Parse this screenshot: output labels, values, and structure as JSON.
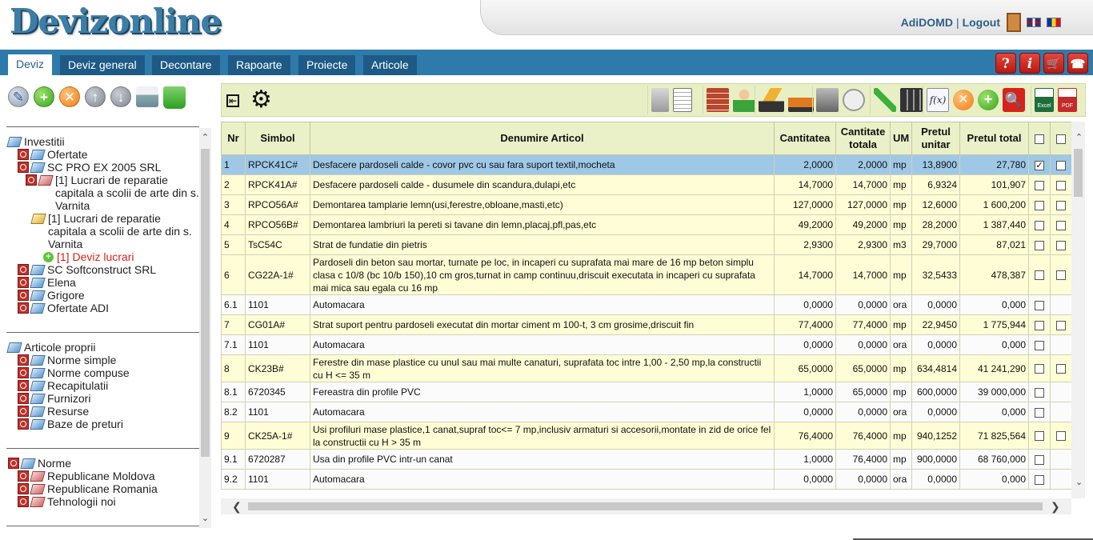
{
  "header": {
    "logo": "Devizonline",
    "user": "AdiDOMD",
    "separator": "|",
    "logout": "Logout"
  },
  "nav": {
    "tabs": [
      {
        "label": "Deviz",
        "active": true
      },
      {
        "label": "Deviz general",
        "active": false
      },
      {
        "label": "Decontare",
        "active": false
      },
      {
        "label": "Rapoarte",
        "active": false
      },
      {
        "label": "Proiecte",
        "active": false
      },
      {
        "label": "Articole",
        "active": false
      }
    ],
    "right_icons": [
      "help-icon",
      "info-icon",
      "cart-icon",
      "phone-icon"
    ],
    "help_label": "?",
    "info_label": "i",
    "cart_label": "🛒",
    "phone_label": "☎"
  },
  "left_toolbar": {
    "pencil": "✎",
    "add": "+",
    "remove": "✕",
    "up": "↑",
    "down": "↓"
  },
  "tree": {
    "investitii": "Investitii",
    "ofertate": "Ofertate",
    "sc_pro_ex": "SC PRO EX 2005 SRL",
    "lucrari_1": "[1] Lucrari de reparatie capitala a scolii de arte din s. Varnita",
    "lucrari_2": "[1] Lucrari de reparatie capitala a scolii de arte din s. Varnita",
    "deviz_lucrari": "[1] Deviz lucrari",
    "softconstruct": "SC Softconstruct SRL",
    "elena": "Elena",
    "grigore": "Grigore",
    "ofertate_adi": "Ofertate ADI",
    "articole_proprii": "Articole proprii",
    "norme_simple": "Norme simple",
    "norme_compuse": "Norme compuse",
    "recapitulatii": "Recapitulatii",
    "furnizori": "Furnizori",
    "resurse": "Resurse",
    "baze_preturi": "Baze de preturi",
    "norme": "Norme",
    "rep_moldova": "Republicane Moldova",
    "rep_romania": "Republicane Romania",
    "tehnologii": "Tehnologii noi"
  },
  "right_toolbar": {
    "back": "⇤",
    "gear": "⚙",
    "fx": "f(x)",
    "remove": "✕",
    "add": "+",
    "search": "🔍",
    "excel": "Excel",
    "pdf": "PDF"
  },
  "table": {
    "headers": {
      "nr": "Nr",
      "simbol": "Simbol",
      "denumire": "Denumire Articol",
      "cantitatea": "Cantitatea",
      "cantitate_totala": "Cantitate totala",
      "um": "UM",
      "pretul_unitar": "Pretul unitar",
      "pretul_total": "Pretul total"
    },
    "rows": [
      {
        "nr": "1",
        "simbol": "RPCK41C#",
        "denumire": "Desfacere pardoseli calde - covor pvc cu sau fara suport textil,mocheta",
        "cant": "2,0000",
        "cant_tot": "2,0000",
        "um": "mp",
        "pu": "13,8900",
        "pt": "27,780",
        "style": "sel",
        "cb1": "✓",
        "cb2": true
      },
      {
        "nr": "2",
        "simbol": "RPCK41A#",
        "denumire": "Desfacere pardoseli calde - dusumele din scandura,dulapi,etc",
        "cant": "14,7000",
        "cant_tot": "14,7000",
        "um": "mp",
        "pu": "6,9324",
        "pt": "101,907",
        "style": "yellow",
        "cb1": "",
        "cb2": true
      },
      {
        "nr": "3",
        "simbol": "RPCO56A#",
        "denumire": "Demontarea tamplarie lemn(usi,ferestre,obloane,masti,etc)",
        "cant": "127,0000",
        "cant_tot": "127,0000",
        "um": "mp",
        "pu": "12,6000",
        "pt": "1 600,200",
        "style": "yellow",
        "cb1": "",
        "cb2": true
      },
      {
        "nr": "4",
        "simbol": "RPCO56B#",
        "denumire": "Demontarea lambriuri la pereti si tavane din lemn,placaj,pfl,pas,etc",
        "cant": "49,2000",
        "cant_tot": "49,2000",
        "um": "mp",
        "pu": "28,2000",
        "pt": "1 387,440",
        "style": "yellow",
        "cb1": "",
        "cb2": true
      },
      {
        "nr": "5",
        "simbol": "TsC54C",
        "denumire": "Strat de fundatie din pietris",
        "cant": "2,9300",
        "cant_tot": "2,9300",
        "um": "m3",
        "pu": "29,7000",
        "pt": "87,021",
        "style": "yellow",
        "cb1": "",
        "cb2": true
      },
      {
        "nr": "6",
        "simbol": "CG22A-1#",
        "denumire": "Pardoseli din beton sau mortar, turnate pe loc, in incaperi cu suprafata mai mare de 16 mp beton simplu clasa c 10/8 (bc 10/b 150),10 cm gros,turnat in camp continuu,driscuit executata in incaperi cu suprafata mai mica sau egala cu 16 mp",
        "cant": "14,7000",
        "cant_tot": "14,7000",
        "um": "mp",
        "pu": "32,5433",
        "pt": "478,387",
        "style": "yellow",
        "cb1": "",
        "cb2": true
      },
      {
        "nr": "6.1",
        "simbol": "1101",
        "denumire": "Automacara",
        "cant": "0,0000",
        "cant_tot": "0,0000",
        "um": "ora",
        "pu": "0,0000",
        "pt": "0,000",
        "style": "white",
        "cb1": "",
        "cb2": false
      },
      {
        "nr": "7",
        "simbol": "CG01A#",
        "denumire": "Strat suport pentru pardoseli executat din mortar ciment m 100-t, 3 cm grosime,driscuit fin",
        "cant": "77,4000",
        "cant_tot": "77,4000",
        "um": "mp",
        "pu": "22,9450",
        "pt": "1 775,944",
        "style": "yellow",
        "cb1": "",
        "cb2": true
      },
      {
        "nr": "7.1",
        "simbol": "1101",
        "denumire": "Automacara",
        "cant": "0,0000",
        "cant_tot": "0,0000",
        "um": "ora",
        "pu": "0,0000",
        "pt": "0,000",
        "style": "white",
        "cb1": "",
        "cb2": false
      },
      {
        "nr": "8",
        "simbol": "CK23B#",
        "denumire": "Ferestre din mase plastice cu unul sau mai multe canaturi, suprafata toc intre 1,00 - 2,50 mp,la constructii cu H <= 35 m",
        "cant": "65,0000",
        "cant_tot": "65,0000",
        "um": "mp",
        "pu": "634,4814",
        "pt": "41 241,290",
        "style": "yellow",
        "cb1": "",
        "cb2": true
      },
      {
        "nr": "8.1",
        "simbol": "6720345",
        "denumire": "Fereastra din profile PVC",
        "cant": "1,0000",
        "cant_tot": "65,0000",
        "um": "mp",
        "pu": "600,0000",
        "pt": "39 000,000",
        "style": "white",
        "cb1": "",
        "cb2": false
      },
      {
        "nr": "8.2",
        "simbol": "1101",
        "denumire": "Automacara",
        "cant": "0,0000",
        "cant_tot": "0,0000",
        "um": "ora",
        "pu": "0,0000",
        "pt": "0,000",
        "style": "white",
        "cb1": "",
        "cb2": false
      },
      {
        "nr": "9",
        "simbol": "CK25A-1#",
        "denumire": "Usi profiluri mase plastice,1 canat,supraf toc<= 7 mp,inclusiv armaturi si accesorii,montate in zid de orice fel la constructii cu H > 35 m",
        "cant": "76,4000",
        "cant_tot": "76,4000",
        "um": "mp",
        "pu": "940,1252",
        "pt": "71 825,564",
        "style": "yellow",
        "cb1": "",
        "cb2": true
      },
      {
        "nr": "9.1",
        "simbol": "6720287",
        "denumire": "Usa din profile PVC intr-un canat",
        "cant": "1,0000",
        "cant_tot": "76,4000",
        "um": "mp",
        "pu": "900,0000",
        "pt": "68 760,000",
        "style": "white",
        "cb1": "",
        "cb2": false
      },
      {
        "nr": "9.2",
        "simbol": "1101",
        "denumire": "Automacara",
        "cant": "0,0000",
        "cant_tot": "0,0000",
        "um": "ora",
        "pu": "0,0000",
        "pt": "0,000",
        "style": "white",
        "cb1": "",
        "cb2": false
      }
    ]
  },
  "scroll": {
    "up": "⌃",
    "down": "⌄",
    "left": "❮",
    "right": "❯"
  }
}
